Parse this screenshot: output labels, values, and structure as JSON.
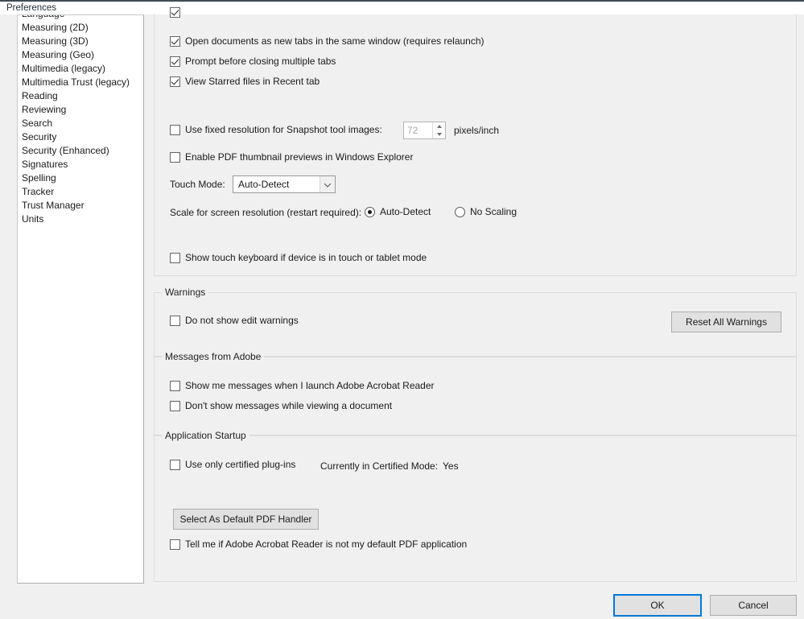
{
  "window": {
    "title": "Preferences"
  },
  "sidebar": {
    "items": [
      {
        "label": "Language",
        "clipped": true
      },
      {
        "label": "Measuring (2D)"
      },
      {
        "label": "Measuring (3D)"
      },
      {
        "label": "Measuring (Geo)"
      },
      {
        "label": "Multimedia (legacy)"
      },
      {
        "label": "Multimedia Trust (legacy)"
      },
      {
        "label": "Reading"
      },
      {
        "label": "Reviewing"
      },
      {
        "label": "Search"
      },
      {
        "label": "Security"
      },
      {
        "label": "Security (Enhanced)"
      },
      {
        "label": "Signatures"
      },
      {
        "label": "Spelling"
      },
      {
        "label": "Tracker"
      },
      {
        "label": "Trust Manager"
      },
      {
        "label": "Units"
      }
    ]
  },
  "main": {
    "application_group": {
      "checkboxes": [
        {
          "label": "Open documents as new tabs in the same window (requires relaunch)",
          "checked": true
        },
        {
          "label": "Prompt before closing multiple tabs",
          "checked": true
        },
        {
          "label": "View Starred files in Recent tab",
          "checked": true
        },
        {
          "label": "Use fixed resolution for Snapshot tool images:",
          "checked": false
        },
        {
          "label": "Enable PDF thumbnail previews in Windows Explorer",
          "checked": false
        },
        {
          "label": "Show touch keyboard if device is in touch or tablet mode",
          "checked": false
        }
      ],
      "snapshot_resolution": {
        "value": "72",
        "unit_label": "pixels/inch"
      },
      "touch_mode": {
        "label": "Touch Mode:",
        "value": "Auto-Detect"
      },
      "scale_screen": {
        "label": "Scale for screen resolution (restart required):",
        "options": [
          {
            "label": "Auto-Detect",
            "selected": true
          },
          {
            "label": "No Scaling",
            "selected": false
          }
        ]
      }
    },
    "warnings_group": {
      "legend": "Warnings",
      "checkbox": {
        "label": "Do not show edit warnings",
        "checked": false
      },
      "reset_button": "Reset All Warnings"
    },
    "messages_group": {
      "legend": "Messages from Adobe",
      "checkboxes": [
        {
          "label": "Show me messages when I launch Adobe Acrobat Reader",
          "checked": false
        },
        {
          "label": "Don't show messages while viewing a document",
          "checked": false
        }
      ]
    },
    "startup_group": {
      "legend": "Application Startup",
      "certified_checkbox": {
        "label": "Use only certified plug-ins",
        "checked": false
      },
      "certified_mode_label": "Currently in Certified Mode:",
      "certified_mode_value": "Yes",
      "default_handler_button": "Select As Default PDF Handler",
      "default_app_checkbox": {
        "label": "Tell me if Adobe Acrobat Reader is not my default PDF application",
        "checked": false
      }
    }
  },
  "footer": {
    "ok_label": "OK",
    "cancel_label": "Cancel"
  }
}
